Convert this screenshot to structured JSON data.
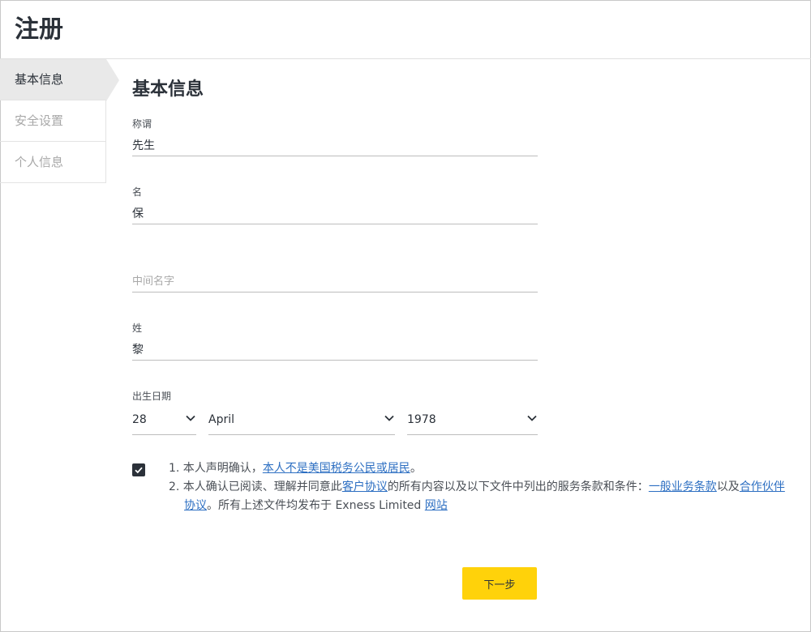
{
  "header": {
    "title": "注册"
  },
  "sidebar": {
    "items": [
      {
        "label": "基本信息"
      },
      {
        "label": "安全设置"
      },
      {
        "label": "个人信息"
      }
    ]
  },
  "main": {
    "section_title": "基本信息"
  },
  "form": {
    "salutation": {
      "label": "称谓",
      "value": "先生"
    },
    "first_name": {
      "label": "名",
      "value": "保"
    },
    "middle_name": {
      "label": "",
      "value": "",
      "placeholder": "中间名字"
    },
    "last_name": {
      "label": "姓",
      "value": "黎"
    },
    "dob": {
      "label": "出生日期",
      "day": "28",
      "month": "April",
      "year": "1978"
    }
  },
  "terms": {
    "checked": true,
    "item1_prefix": "1. 本人声明确认，",
    "item1_link": "本人不是美国税务公民或居民",
    "item1_suffix": "。",
    "item2_prefix": "2. 本人确认已阅读、理解并同意此",
    "item2_link1": "客户协议",
    "item2_mid1": "的所有内容以及以下文件中列出的服务条款和条件：",
    "item2_link2": "一般业务条款",
    "item2_mid2": "以及",
    "item2_link3": "合作伙伴协议",
    "item2_mid3": "。所有上述文件均发布于 Exness Limited ",
    "item2_link4": "网站"
  },
  "buttons": {
    "next_label": "下一步"
  },
  "colors": {
    "accent": "#ffd20a",
    "link": "#2d6fc2",
    "text": "#2b3139"
  },
  "icons": {
    "dropdown": "chevron-down-icon",
    "checkbox": "checkmark-icon"
  }
}
